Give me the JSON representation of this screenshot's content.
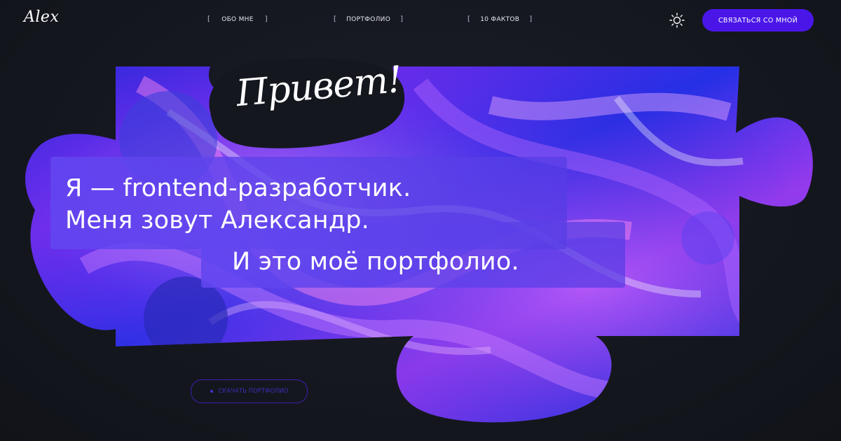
{
  "header": {
    "logo": "Alex",
    "nav": [
      {
        "label": "ОБО МНЕ"
      },
      {
        "label": "ПОРТФОЛИО"
      },
      {
        "label": "10 ФАКТОВ"
      }
    ],
    "bracket_open": "[",
    "bracket_close": "]",
    "theme_icon": "sun-icon",
    "cta_label": "СВЯЗАТЬСЯ СО МНОЙ"
  },
  "hero": {
    "greeting": "Привет!",
    "line1": "Я — frontend-разработчик.",
    "line2": "Меня зовут Александр.",
    "line3": "И это моё портфолио.",
    "scroll_button": "СКАЧАТЬ ПОРТФОЛИО"
  },
  "colors": {
    "background": "#15171f",
    "accent": "#4a16e8",
    "art_blue": "#2a2fe0",
    "art_purple": "#8a2be8"
  }
}
